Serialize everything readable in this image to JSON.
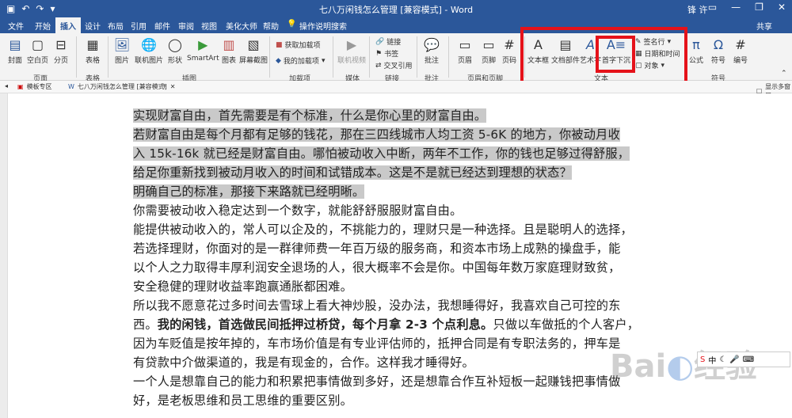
{
  "window": {
    "title": "七八万闲钱怎么管理 [兼容模式] - Word",
    "user": "锋 许",
    "share": "共享"
  },
  "tabs": [
    "文件",
    "开始",
    "插入",
    "设计",
    "布局",
    "引用",
    "邮件",
    "审阅",
    "视图",
    "美化大师",
    "帮助",
    "操作说明搜索"
  ],
  "active_tab": "插入",
  "ribbon": {
    "buttons": [
      "封面",
      "空白页",
      "分页",
      "表格",
      "图片",
      "联机图片",
      "形状",
      "SmartArt",
      "图表",
      "屏幕截图",
      "联机视频",
      "批注",
      "页眉",
      "页脚",
      "页码",
      "文本框",
      "文档部件",
      "艺术字",
      "首字下沉",
      "公式",
      "符号",
      "编号"
    ],
    "addin_items": [
      "获取加载项",
      "我的加载项"
    ],
    "link_items": [
      "链接",
      "书签",
      "交叉引用"
    ],
    "text_small": [
      "签名行",
      "日期和时间",
      "对象"
    ],
    "groups": [
      "页面",
      "表格",
      "插图",
      "加载项",
      "媒体",
      "链接",
      "批注",
      "页眉和页脚",
      "文本",
      "符号"
    ]
  },
  "doc_tabs": [
    "模板专区",
    "七八万闲钱怎么管理 [兼容模式]"
  ],
  "display_hint": "显示多窗口",
  "document": {
    "lines": [
      "实现财富自由，首先需要是有个标准，什么是你心里的财富自由。",
      "若财富自由是每个月都有足够的钱花，那在三四线城市人均工资 5-6K 的地方，你被动月收",
      "入 15k-16k 就已经是财富自由。哪怕被动收入中断，两年不工作，你的钱也足够过得舒服，",
      "给足你重新找到被动月收入的时间和试错成本。这是不是就已经达到理想的状态？",
      "明确自己的标准，那接下来路就已经明晰。",
      "你需要被动收入稳定达到一个数字，就能舒舒服服财富自由。",
      "能提供被动收入的，常人可以企及的，不挑能力的，理财只是一种选择。且是聪明人的选择，",
      "若选择理财，你面对的是一群律师费一年百万级的服务商，和资本市场上成熟的操盘手，能",
      "以个人之力取得丰厚利润安全退场的人，很大概率不会是你。中国每年数万家庭理财致贫，",
      "安全稳健的理财收益率跑赢通胀都困难。",
      "所以我不愿意花过多时间去雪球上看大神炒股，没办法，我想睡得好，我喜欢自己可控的东",
      "西。",
      "我的闲钱，首选做民间抵押过桥贷，每个月拿 2-3 个点利息。",
      "只做以车做抵的个人客户，",
      "因为车贬值是按年掉的，车市场价值是有专业评估师的，抵押合同是有专职法务的，押车是",
      "有贷款中介做渠道的，我是有现金的，合作。这样我才睡得好。",
      "一个人是想靠自己的能力和积累把事情做到多好，还是想靠合作互补短板一起赚钱把事情做",
      "好，是老板思维和员工思维的重要区别。"
    ]
  },
  "watermark": "Bai经验",
  "ime": "中"
}
